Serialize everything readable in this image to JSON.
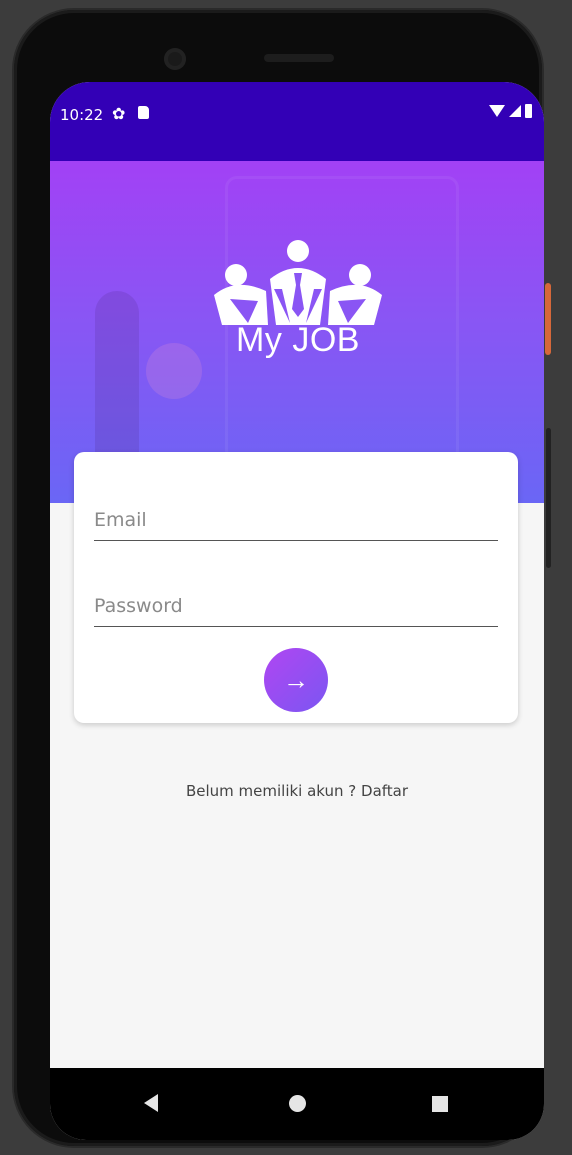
{
  "status_bar": {
    "time": "10:22",
    "icons": [
      "gear-icon",
      "sd-card-icon",
      "wifi-icon",
      "signal-icon",
      "battery-icon"
    ]
  },
  "header": {
    "logo_text": "My JOB"
  },
  "login_form": {
    "email_placeholder": "Email",
    "password_placeholder": "Password",
    "submit_icon": "arrow-right-icon",
    "submit_glyph": "→"
  },
  "register_link": "Belum memiliki akun ? Daftar",
  "colors": {
    "status_bar": "#3300b6",
    "header_gradient_top": "#a241f5",
    "header_gradient_bottom": "#6a66f5",
    "button_gradient": "#9a4ef2",
    "background": "#f6f6f6"
  },
  "nav_bar": {
    "buttons": [
      "back-icon",
      "home-icon",
      "recents-icon"
    ]
  }
}
